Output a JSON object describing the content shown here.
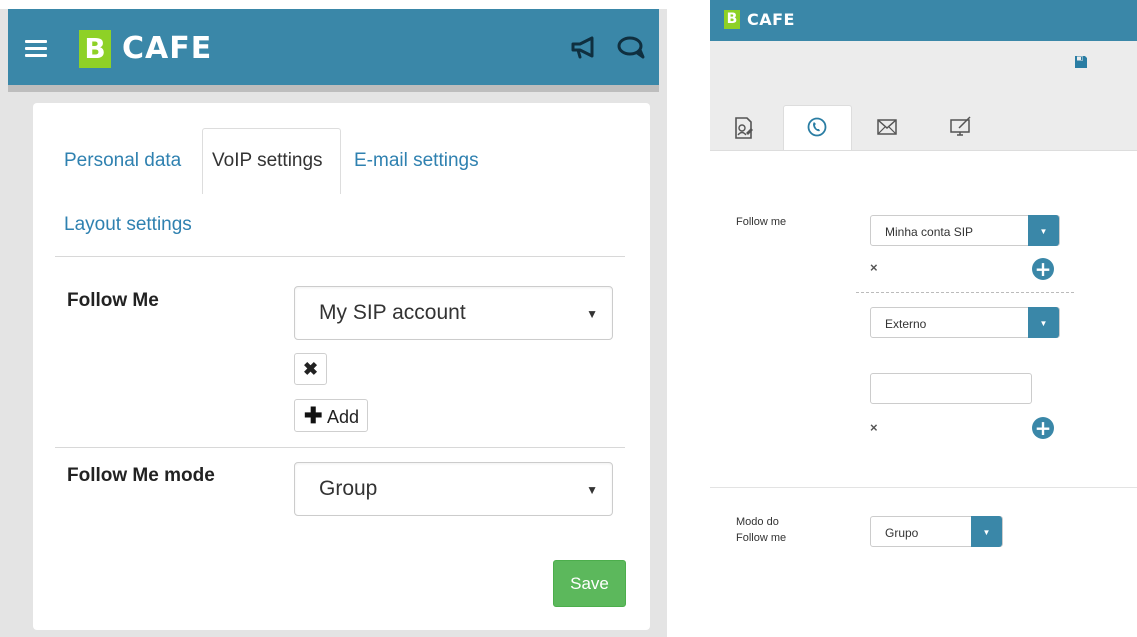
{
  "left": {
    "brand": {
      "logo_letter": "B",
      "name": "CAFE"
    },
    "header_icons": [
      "hamburger-menu-icon",
      "megaphone-icon",
      "chat-icon"
    ],
    "tabs": [
      {
        "label": "Personal data",
        "active": false
      },
      {
        "label": "VoIP settings",
        "active": true
      },
      {
        "label": "E-mail settings",
        "active": false
      },
      {
        "label": "Layout settings",
        "active": false
      }
    ],
    "follow_me": {
      "label": "Follow Me",
      "selected": "My SIP account",
      "remove_symbol": "✖",
      "add_label": "Add",
      "add_symbol": "✚"
    },
    "follow_me_mode": {
      "label": "Follow Me mode",
      "selected": "Group"
    },
    "save_label": "Save",
    "caret_symbol": "▼"
  },
  "right": {
    "brand": {
      "logo_letter": "B",
      "name": "CAFE"
    },
    "tab_icons": [
      "contact-card-icon",
      "phone-icon",
      "mail-icon",
      "monitor-icon"
    ],
    "active_tab": "phone-icon",
    "follow_me": {
      "label": "Follow me",
      "entries": [
        {
          "selected": "Minha conta SIP",
          "remove_symbol": "×",
          "add_symbol": "+"
        },
        {
          "selected": "Externo",
          "input_value": "",
          "remove_symbol": "×",
          "add_symbol": "+"
        }
      ]
    },
    "follow_me_mode": {
      "label_line1": "Modo do",
      "label_line2": "Follow me",
      "selected": "Grupo"
    },
    "caret_symbol": "▼"
  },
  "colors": {
    "header": "#3a87a8",
    "brand_green": "#8ed126",
    "link_blue": "#2f81b0",
    "save_green": "#5cb85c"
  }
}
